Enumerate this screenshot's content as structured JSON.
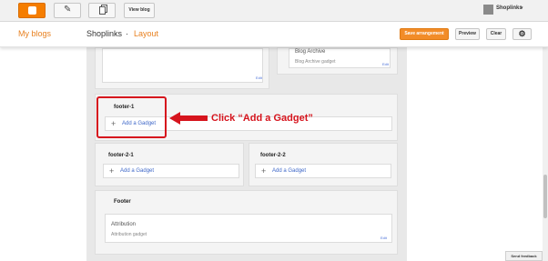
{
  "topbar": {
    "view_blog_label": "View blog",
    "user_name": "Shoplinks",
    "caret": "▾",
    "icons": [
      "blogger-logo-icon",
      "pencil-icon",
      "pages-icon",
      "chevron-down-icon"
    ]
  },
  "header": {
    "my_blogs": "My blogs",
    "blog_name": "Shoplinks",
    "separator": "·",
    "page": "Layout",
    "save_label": "Save arrangement",
    "preview_label": "Preview",
    "clear_label": "Clear",
    "settings_icon": "gear-icon",
    "accent_color": "#e8801f"
  },
  "layout": {
    "top_left_gadget": {
      "edit": "Edit"
    },
    "top_right_gadget": {
      "name": "Blog Archive",
      "type": "Blog Archive gadget",
      "edit": "Edit"
    },
    "footer_1": {
      "title": "footer-1",
      "add_label": "Add a Gadget"
    },
    "footer_2_1": {
      "title": "footer-2-1",
      "add_label": "Add a Gadget"
    },
    "footer_2_2": {
      "title": "footer-2-2",
      "add_label": "Add a Gadget"
    },
    "footer": {
      "title": "Footer",
      "gadget": {
        "name": "Attribution",
        "type": "Attribution gadget",
        "edit": "Edit"
      }
    },
    "plus_glyph": "+"
  },
  "annotation": {
    "callout": "Click “Add a Gadget”",
    "color": "#d6141d"
  },
  "feedback": {
    "label": "Send feedback"
  }
}
